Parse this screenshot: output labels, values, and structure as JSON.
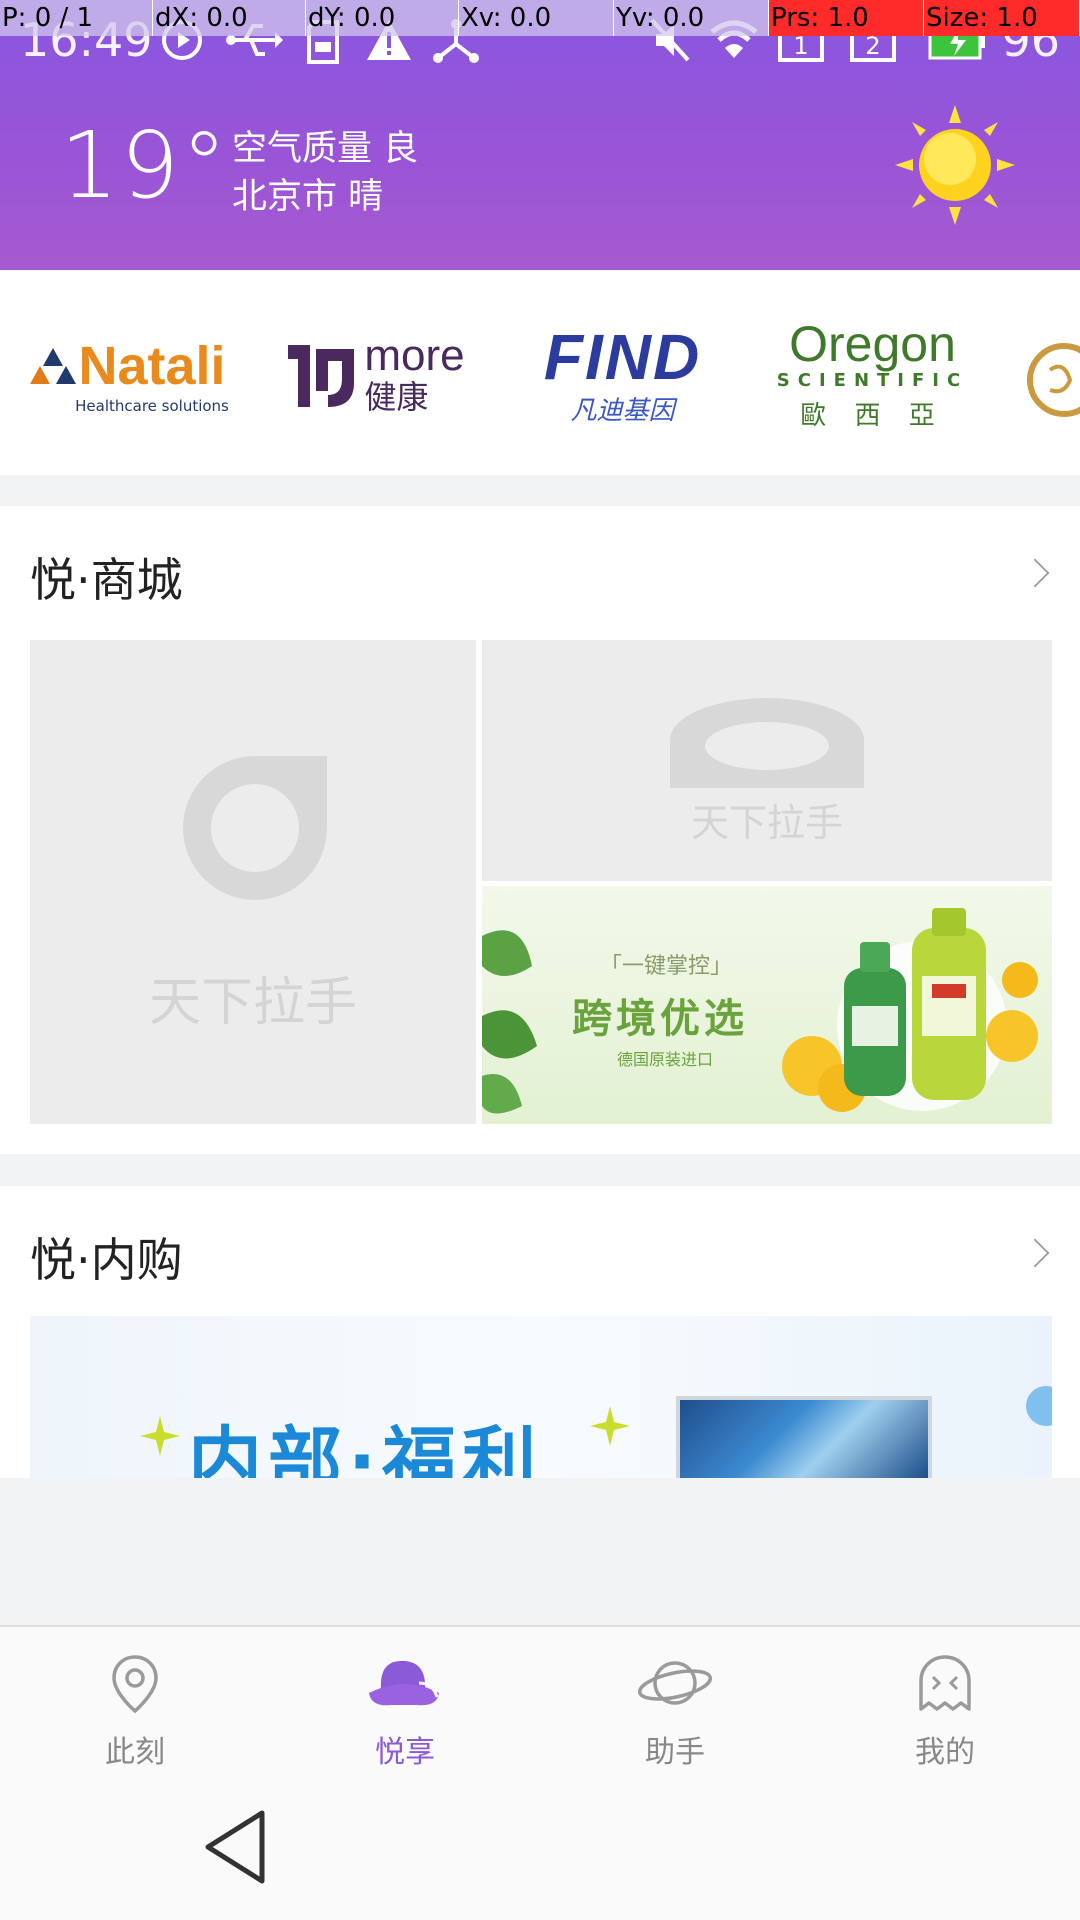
{
  "debug": {
    "p": "P: 0 / 1",
    "dx": "dX: 0.0",
    "dy": "dY: 0.0",
    "xv": "Xv: 0.0",
    "yv": "Yv: 0.0",
    "prs": "Prs: 1.0",
    "size": "Size: 1.0"
  },
  "status": {
    "time": "16:49",
    "battery": "96"
  },
  "weather": {
    "temp": "19°",
    "air_quality": "空气质量 良",
    "city_weather": "北京市 晴",
    "icon": "sun-icon"
  },
  "brands": [
    {
      "name": "Natali",
      "sub": "Healthcare solutions"
    },
    {
      "name": "more",
      "sub": "健康"
    },
    {
      "name": "FIND",
      "sub": "凡迪基因"
    },
    {
      "name": "Oregon",
      "sub": "SCIENTIFIC",
      "sub2": "歐 西 亞"
    }
  ],
  "mall": {
    "title": "悦·商城",
    "placeholder_text": "天下拉手",
    "promo": {
      "tag": "「一键掌控」",
      "headline": "跨境优选",
      "sub": "德国原装进口"
    }
  },
  "internal": {
    "title": "悦·内购",
    "banner_text": "内部·福利"
  },
  "nav": {
    "items": [
      {
        "label": "此刻",
        "icon": "location-pin-icon"
      },
      {
        "label": "悦享",
        "icon": "hat-icon"
      },
      {
        "label": "助手",
        "icon": "planet-icon"
      },
      {
        "label": "我的",
        "icon": "ghost-icon"
      }
    ],
    "active_color": "#8a5ad9"
  },
  "colors": {
    "header_top": "#8856e0",
    "header_bottom": "#a65ad0"
  }
}
